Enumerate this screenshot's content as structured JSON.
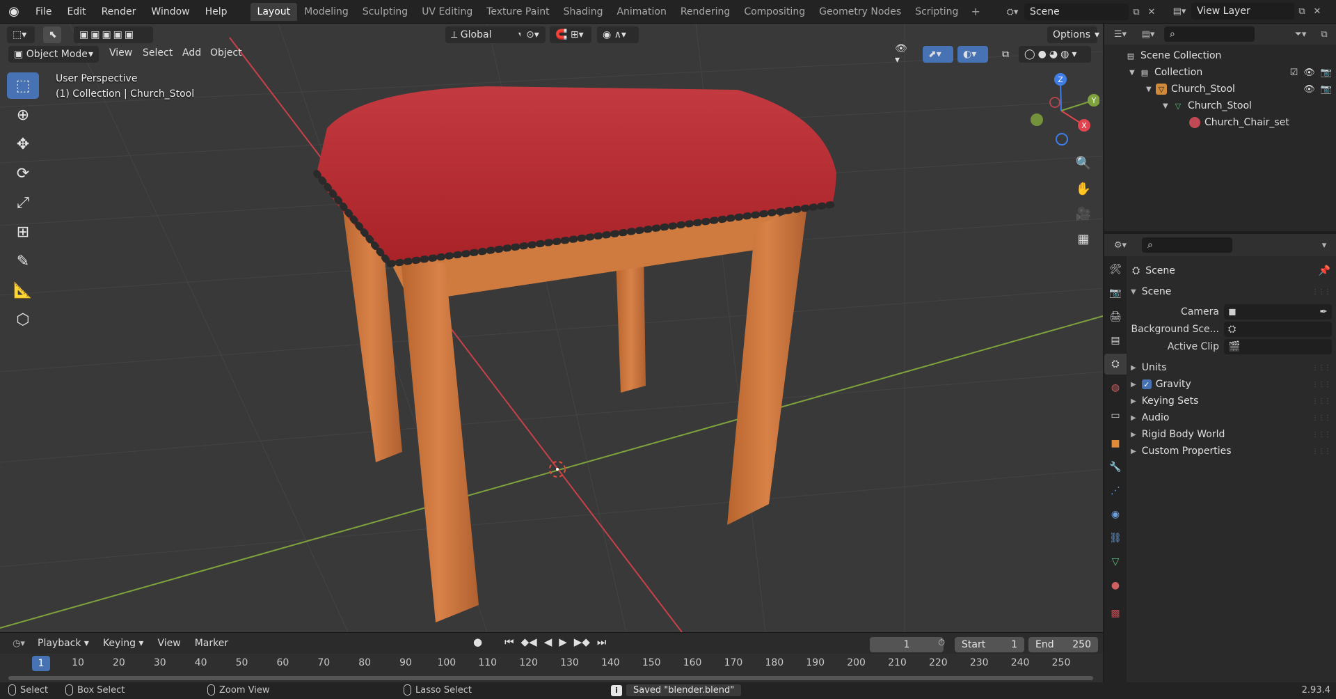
{
  "topbar": {
    "menus": [
      "File",
      "Edit",
      "Render",
      "Window",
      "Help"
    ],
    "workspaces": [
      "Layout",
      "Modeling",
      "Sculpting",
      "UV Editing",
      "Texture Paint",
      "Shading",
      "Animation",
      "Rendering",
      "Compositing",
      "Geometry Nodes",
      "Scripting"
    ],
    "active_workspace": "Layout",
    "add_workspace": "+",
    "scene_name": "Scene",
    "view_layer_name": "View Layer"
  },
  "viewport": {
    "orientation": "Global",
    "options_label": "Options",
    "mode": "Object Mode",
    "menus": [
      "View",
      "Select",
      "Add",
      "Object"
    ],
    "overlay_line1": "User Perspective",
    "overlay_line2": "(1) Collection | Church_Stool",
    "gizmo": {
      "x": "X",
      "y": "Y",
      "z": "Z"
    }
  },
  "timeline": {
    "menus": [
      "Playback",
      "Keying",
      "View",
      "Marker"
    ],
    "current_frame": "1",
    "start_label": "Start",
    "start_value": "1",
    "end_label": "End",
    "end_value": "250",
    "ticks": [
      "1",
      "10",
      "20",
      "30",
      "40",
      "50",
      "60",
      "70",
      "80",
      "90",
      "100",
      "110",
      "120",
      "130",
      "140",
      "150",
      "160",
      "170",
      "180",
      "190",
      "200",
      "210",
      "220",
      "230",
      "240",
      "250"
    ]
  },
  "statusbar": {
    "select": "Select",
    "box_select": "Box Select",
    "zoom_view": "Zoom View",
    "lasso_select": "Lasso Select",
    "message": "Saved \"blender.blend\"",
    "version": "2.93.4"
  },
  "outliner": {
    "root": "Scene Collection",
    "collection": "Collection",
    "object": "Church_Stool",
    "mesh": "Church_Stool",
    "material": "Church_Chair_set"
  },
  "properties": {
    "context_name": "Scene",
    "panel_title": "Scene",
    "camera_label": "Camera",
    "background_label": "Background Sce...",
    "active_clip_label": "Active Clip",
    "panels": [
      "Units",
      "Gravity",
      "Keying Sets",
      "Audio",
      "Rigid Body World",
      "Custom Properties"
    ]
  },
  "colors": {
    "accent": "#4772b3",
    "axis_x": "#c8404a",
    "axis_y": "#7ea23c",
    "seat": "#b8262c",
    "wood": "#c9743a"
  }
}
